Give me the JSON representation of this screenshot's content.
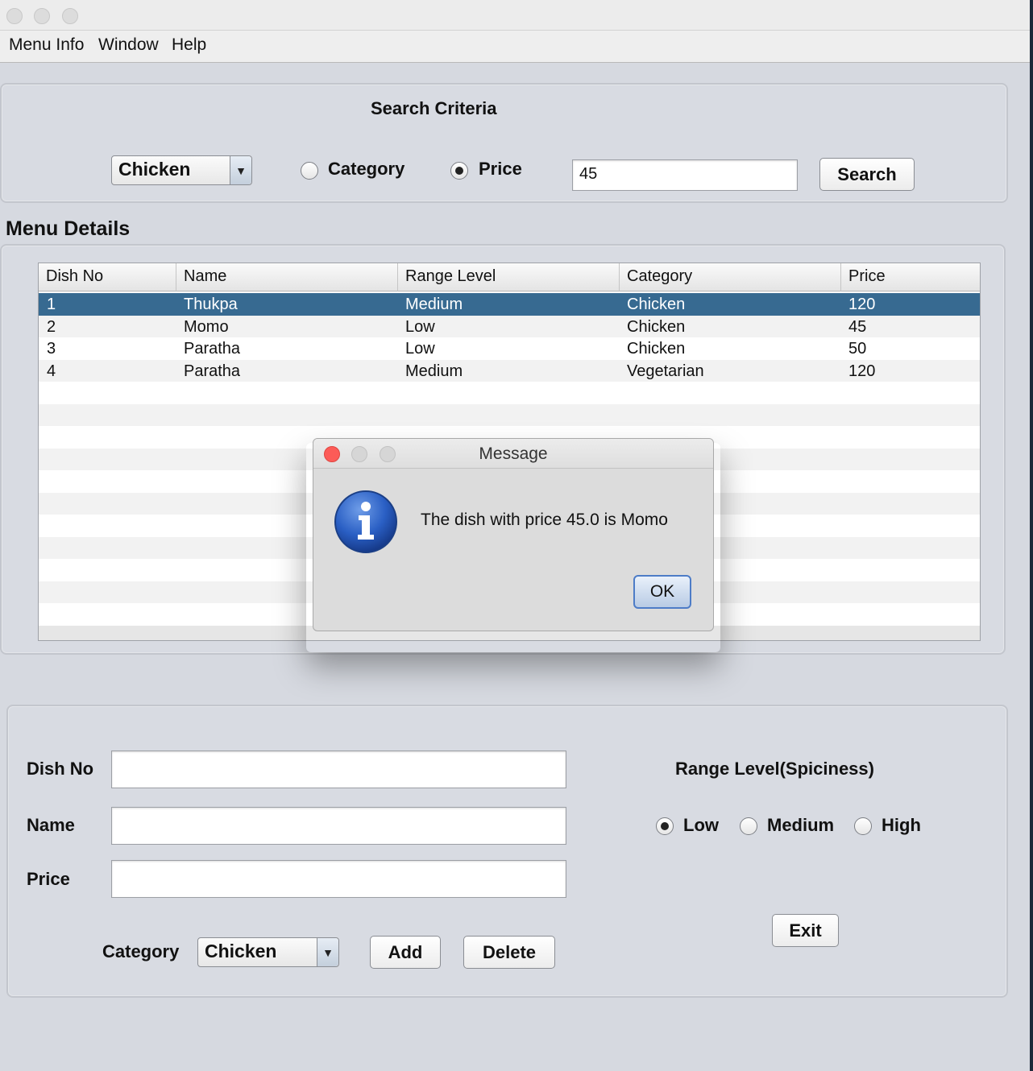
{
  "menubar": {
    "items": [
      "Menu Info",
      "Window",
      "Help"
    ]
  },
  "search": {
    "title": "Search Criteria",
    "combo_value": "Chicken",
    "radio_category": "Category",
    "radio_price": "Price",
    "selected_radio": "Price",
    "input_value": "45",
    "button_label": "Search"
  },
  "menu_details": {
    "title": "Menu Details",
    "columns": [
      "Dish No",
      "Name",
      "Range Level",
      "Category",
      "Price"
    ],
    "rows": [
      [
        "1",
        "Thukpa",
        "Medium",
        "Chicken",
        "120"
      ],
      [
        "2",
        "Momo",
        "Low",
        "Chicken",
        "45"
      ],
      [
        "3",
        "Paratha",
        "Low",
        "Chicken",
        "50"
      ],
      [
        "4",
        "Paratha",
        "Medium",
        "Vegetarian",
        "120"
      ]
    ],
    "selected_row": 0
  },
  "form": {
    "dish_no_label": "Dish No",
    "name_label": "Name",
    "price_label": "Price",
    "category_label": "Category",
    "category_value": "Chicken",
    "add_label": "Add",
    "delete_label": "Delete",
    "range_title": "Range Level(Spiciness)",
    "range_options": [
      "Low",
      "Medium",
      "High"
    ],
    "range_selected": "Low",
    "exit_label": "Exit"
  },
  "dialog": {
    "title": "Message",
    "message": "The dish with price 45.0 is  Momo",
    "ok_label": "OK",
    "icon": "info-icon"
  }
}
